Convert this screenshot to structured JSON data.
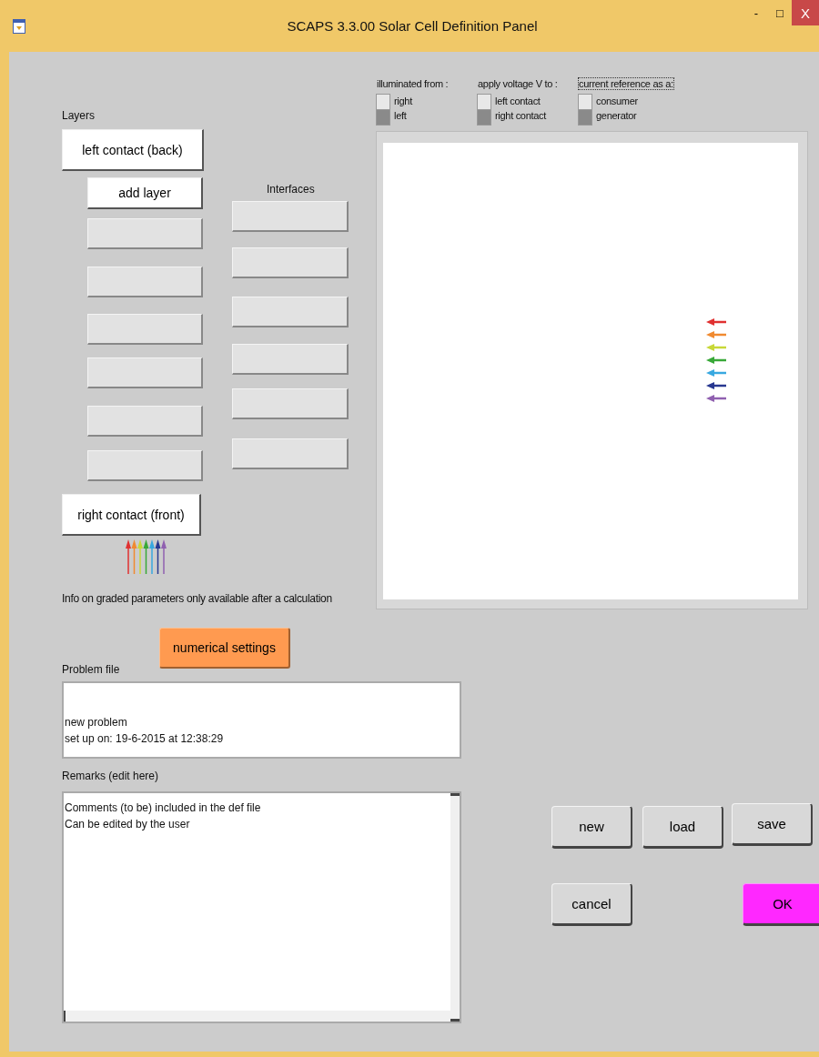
{
  "window": {
    "title": "SCAPS 3.3.00 Solar Cell Definition Panel",
    "controls": [
      "-",
      "□",
      "X"
    ]
  },
  "layers": {
    "label": "Layers",
    "left_contact": "left contact (back)",
    "add_layer": "add layer",
    "right_contact": "right contact (front)"
  },
  "interfaces": {
    "label": "Interfaces"
  },
  "info": "Info on graded parameters only available after a calculation",
  "numerical_settings": "numerical settings",
  "problem_file": {
    "label": "Problem file",
    "lines": [
      "new problem",
      "set up on: 19-6-2015 at 12:38:29"
    ]
  },
  "remarks": {
    "label": "Remarks (edit here)",
    "lines": [
      "Comments (to be) included in the def file",
      "Can be edited by the user"
    ]
  },
  "option_groups": [
    {
      "title": "illuminated from :",
      "focused": false,
      "options": [
        {
          "label": "right",
          "selected": true
        },
        {
          "label": "left",
          "selected": false
        }
      ]
    },
    {
      "title": "apply voltage V to :",
      "focused": false,
      "options": [
        {
          "label": "left contact",
          "selected": true
        },
        {
          "label": "right contact",
          "selected": false
        }
      ]
    },
    {
      "title": "current reference as a:",
      "focused": true,
      "options": [
        {
          "label": "consumer",
          "selected": true
        },
        {
          "label": "generator",
          "selected": false
        }
      ]
    }
  ],
  "buttons": [
    {
      "label": "new",
      "kind": "plain"
    },
    {
      "label": "load",
      "kind": "plain"
    },
    {
      "label": "save",
      "kind": "plain"
    },
    {
      "label": "cancel",
      "kind": "plain"
    },
    {
      "label": "OK",
      "kind": "primary"
    }
  ]
}
